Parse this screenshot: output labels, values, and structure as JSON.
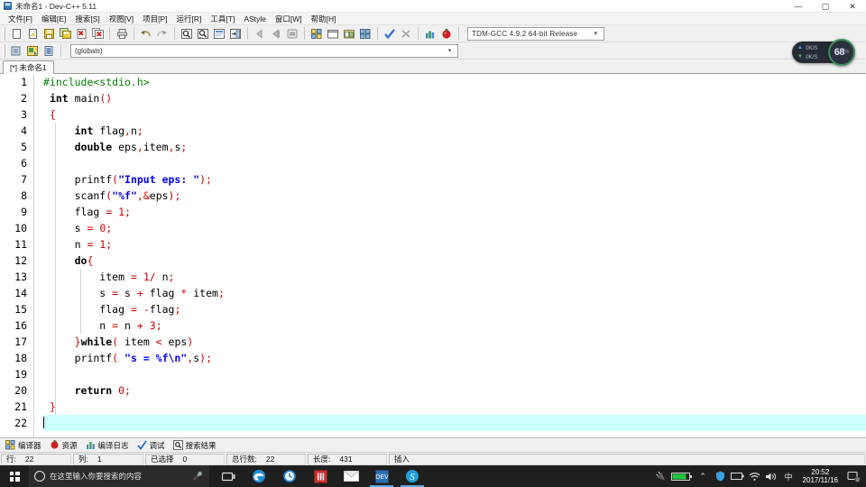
{
  "window": {
    "title": "未命名1 - Dev-C++ 5.11",
    "app_icon": "devcpp-icon",
    "buttons": {
      "minimize": "—",
      "maximize": "▢",
      "close": "✕"
    }
  },
  "menubar": {
    "items": [
      {
        "label": "文件[F]"
      },
      {
        "label": "编辑[E]"
      },
      {
        "label": "搜索[S]"
      },
      {
        "label": "视图[V]"
      },
      {
        "label": "项目[P]"
      },
      {
        "label": "运行[R]"
      },
      {
        "label": "工具[T]"
      },
      {
        "label": "AStyle"
      },
      {
        "label": "窗口[W]"
      },
      {
        "label": "帮助[H]"
      }
    ]
  },
  "toolbar": {
    "compiler_combo": {
      "value": "TDM-GCC 4.9.2 64-bit Release",
      "arrow": "▾"
    },
    "scope_combo": {
      "value": "(globals)",
      "arrow": "▾"
    },
    "icons": [
      "new-file-icon",
      "open-file-icon",
      "save-file-icon",
      "save-all-icon",
      "close-file-icon",
      "close-all-icon",
      "print-icon",
      "undo-icon",
      "redo-icon",
      "find-icon",
      "find-next-icon",
      "replace-icon",
      "goto-line-icon",
      "back-icon",
      "forward-icon",
      "toggle-breakpoint-icon",
      "project-manager-icon",
      "window-icon",
      "window-tile-icon",
      "window-cascade-icon",
      "compile-icon",
      "abort-icon",
      "run-icon",
      "compile-run-icon"
    ],
    "row2_icons": [
      "insert-icon",
      "toggle-icon",
      "goto-function-icon"
    ]
  },
  "tabs": {
    "items": [
      {
        "label": "[*] 未命名1"
      }
    ]
  },
  "editor": {
    "gutter_digits": [
      "1",
      "2",
      "3",
      "4",
      "5",
      "6",
      "7",
      "8",
      "9",
      "10",
      "11",
      "12",
      "13",
      "14",
      "15",
      "16",
      "17",
      "18",
      "19",
      "20",
      "21",
      "22"
    ],
    "current_line": 22,
    "lines": [
      {
        "n": "1",
        "tokens": [
          {
            "t": "#include<stdio.h>",
            "c": "pp"
          }
        ]
      },
      {
        "n": "2",
        "tokens": [
          {
            "t": " ",
            "c": "plain"
          },
          {
            "t": "int",
            "c": "kw"
          },
          {
            "t": " main",
            "c": "plain"
          },
          {
            "t": "()",
            "c": "sym"
          }
        ]
      },
      {
        "n": "3",
        "tokens": [
          {
            "t": " ",
            "c": "plain"
          },
          {
            "t": "{",
            "c": "sym"
          }
        ],
        "fold": "open"
      },
      {
        "n": "4",
        "tokens": [
          {
            "t": "     ",
            "c": "plain"
          },
          {
            "t": "int",
            "c": "kw"
          },
          {
            "t": " flag",
            "c": "plain"
          },
          {
            "t": ",",
            "c": "sym"
          },
          {
            "t": "n",
            "c": "plain"
          },
          {
            "t": ";",
            "c": "sym"
          }
        ]
      },
      {
        "n": "5",
        "tokens": [
          {
            "t": "     ",
            "c": "plain"
          },
          {
            "t": "double",
            "c": "kw"
          },
          {
            "t": " eps",
            "c": "plain"
          },
          {
            "t": ",",
            "c": "sym"
          },
          {
            "t": "item",
            "c": "plain"
          },
          {
            "t": ",",
            "c": "sym"
          },
          {
            "t": "s",
            "c": "plain"
          },
          {
            "t": ";",
            "c": "sym"
          }
        ]
      },
      {
        "n": "6",
        "tokens": [
          {
            "t": "",
            "c": "plain"
          }
        ]
      },
      {
        "n": "7",
        "tokens": [
          {
            "t": "     printf",
            "c": "plain"
          },
          {
            "t": "(",
            "c": "sym"
          },
          {
            "t": "\"Input eps: \"",
            "c": "str"
          },
          {
            "t": ");",
            "c": "sym"
          }
        ]
      },
      {
        "n": "8",
        "tokens": [
          {
            "t": "     scanf",
            "c": "plain"
          },
          {
            "t": "(",
            "c": "sym"
          },
          {
            "t": "\"%f\"",
            "c": "str"
          },
          {
            "t": ",",
            "c": "sym"
          },
          {
            "t": "&",
            "c": "sym"
          },
          {
            "t": "eps",
            "c": "plain"
          },
          {
            "t": ");",
            "c": "sym"
          }
        ]
      },
      {
        "n": "9",
        "tokens": [
          {
            "t": "     flag ",
            "c": "plain"
          },
          {
            "t": "=",
            "c": "sym"
          },
          {
            "t": " ",
            "c": "plain"
          },
          {
            "t": "1",
            "c": "num"
          },
          {
            "t": ";",
            "c": "sym"
          }
        ]
      },
      {
        "n": "10",
        "tokens": [
          {
            "t": "     s ",
            "c": "plain"
          },
          {
            "t": "=",
            "c": "sym"
          },
          {
            "t": " ",
            "c": "plain"
          },
          {
            "t": "0",
            "c": "num"
          },
          {
            "t": ";",
            "c": "sym"
          }
        ]
      },
      {
        "n": "11",
        "tokens": [
          {
            "t": "     n ",
            "c": "plain"
          },
          {
            "t": "=",
            "c": "sym"
          },
          {
            "t": " ",
            "c": "plain"
          },
          {
            "t": "1",
            "c": "num"
          },
          {
            "t": ";",
            "c": "sym"
          }
        ]
      },
      {
        "n": "12",
        "tokens": [
          {
            "t": "     ",
            "c": "plain"
          },
          {
            "t": "do",
            "c": "kw"
          },
          {
            "t": "{",
            "c": "sym"
          }
        ],
        "fold": "open"
      },
      {
        "n": "13",
        "tokens": [
          {
            "t": "         item ",
            "c": "plain"
          },
          {
            "t": "=",
            "c": "sym"
          },
          {
            "t": " ",
            "c": "plain"
          },
          {
            "t": "1",
            "c": "num"
          },
          {
            "t": "/",
            "c": "sym"
          },
          {
            "t": " n",
            "c": "plain"
          },
          {
            "t": ";",
            "c": "sym"
          }
        ]
      },
      {
        "n": "14",
        "tokens": [
          {
            "t": "         s ",
            "c": "plain"
          },
          {
            "t": "=",
            "c": "sym"
          },
          {
            "t": " s ",
            "c": "plain"
          },
          {
            "t": "+",
            "c": "sym"
          },
          {
            "t": " flag ",
            "c": "plain"
          },
          {
            "t": "*",
            "c": "sym"
          },
          {
            "t": " item",
            "c": "plain"
          },
          {
            "t": ";",
            "c": "sym"
          }
        ]
      },
      {
        "n": "15",
        "tokens": [
          {
            "t": "         flag ",
            "c": "plain"
          },
          {
            "t": "=",
            "c": "sym"
          },
          {
            "t": " ",
            "c": "plain"
          },
          {
            "t": "-",
            "c": "sym"
          },
          {
            "t": "flag",
            "c": "plain"
          },
          {
            "t": ";",
            "c": "sym"
          }
        ]
      },
      {
        "n": "16",
        "tokens": [
          {
            "t": "         n ",
            "c": "plain"
          },
          {
            "t": "=",
            "c": "sym"
          },
          {
            "t": " n ",
            "c": "plain"
          },
          {
            "t": "+",
            "c": "sym"
          },
          {
            "t": " ",
            "c": "plain"
          },
          {
            "t": "3",
            "c": "num"
          },
          {
            "t": ";",
            "c": "sym"
          }
        ]
      },
      {
        "n": "17",
        "tokens": [
          {
            "t": "     ",
            "c": "plain"
          },
          {
            "t": "}",
            "c": "sym"
          },
          {
            "t": "while",
            "c": "kw"
          },
          {
            "t": "(",
            "c": "sym"
          },
          {
            "t": " item ",
            "c": "plain"
          },
          {
            "t": "<",
            "c": "sym"
          },
          {
            "t": " eps",
            "c": "plain"
          },
          {
            "t": ")",
            "c": "sym"
          }
        ],
        "fold": "close"
      },
      {
        "n": "18",
        "tokens": [
          {
            "t": "     printf",
            "c": "plain"
          },
          {
            "t": "(",
            "c": "sym"
          },
          {
            "t": " ",
            "c": "plain"
          },
          {
            "t": "\"s = %f\\n\"",
            "c": "str"
          },
          {
            "t": ",",
            "c": "sym"
          },
          {
            "t": "s",
            "c": "plain"
          },
          {
            "t": ");",
            "c": "sym"
          }
        ]
      },
      {
        "n": "19",
        "tokens": [
          {
            "t": "",
            "c": "plain"
          }
        ]
      },
      {
        "n": "20",
        "tokens": [
          {
            "t": "     ",
            "c": "plain"
          },
          {
            "t": "return",
            "c": "kw"
          },
          {
            "t": " ",
            "c": "plain"
          },
          {
            "t": "0",
            "c": "num"
          },
          {
            "t": ";",
            "c": "sym"
          }
        ]
      },
      {
        "n": "21",
        "tokens": [
          {
            "t": " ",
            "c": "plain"
          },
          {
            "t": "}",
            "c": "sym"
          }
        ],
        "fold": "close"
      },
      {
        "n": "22",
        "tokens": [
          {
            "t": "",
            "c": "plain"
          }
        ],
        "current": true
      }
    ]
  },
  "panel_tabs": {
    "items": [
      {
        "label": "编译器",
        "icon": "compiler-icon"
      },
      {
        "label": "资源",
        "icon": "resource-icon"
      },
      {
        "label": "编译日志",
        "icon": "log-icon"
      },
      {
        "label": "调试",
        "icon": "debug-icon"
      },
      {
        "label": "搜索结果",
        "icon": "search-results-icon"
      }
    ]
  },
  "statusbar": {
    "cells": [
      {
        "label": "行:",
        "value": "22"
      },
      {
        "label": "列:",
        "value": "1"
      },
      {
        "label": "已选择",
        "value": "0"
      },
      {
        "label": "总行数:",
        "value": "22"
      },
      {
        "label": "长度:",
        "value": "431"
      },
      {
        "label": "插入",
        "value": ""
      }
    ]
  },
  "netwidget": {
    "upload": "0K/S",
    "download": "0K/S",
    "percent": "68",
    "percent_sign": "%",
    "ring_color": "#3e8e5e"
  },
  "taskbar": {
    "start_label": "start-button",
    "search_placeholder": "在这里输入你要搜索的内容",
    "apps": [
      {
        "name": "task-view-icon"
      },
      {
        "name": "edge-icon"
      },
      {
        "name": "clock-app-icon"
      },
      {
        "name": "red-app-icon"
      },
      {
        "name": "mail-icon"
      },
      {
        "name": "devcpp-taskbar-icon"
      },
      {
        "name": "skype-icon"
      }
    ],
    "tray": {
      "battery_pct": "83%",
      "icons": [
        "chevron-up-icon",
        "security-icon",
        "battery-icon",
        "wifi-icon",
        "volume-icon"
      ],
      "ime": "中",
      "time": "20:52",
      "date": "2017/11/16",
      "notifications": "2"
    }
  },
  "colors": {
    "preprocessor": "#008000",
    "string": "#0000ff",
    "symbol": "#cc0000",
    "current_line_bg": "#ccffff",
    "accent": "#3e8e5e"
  }
}
